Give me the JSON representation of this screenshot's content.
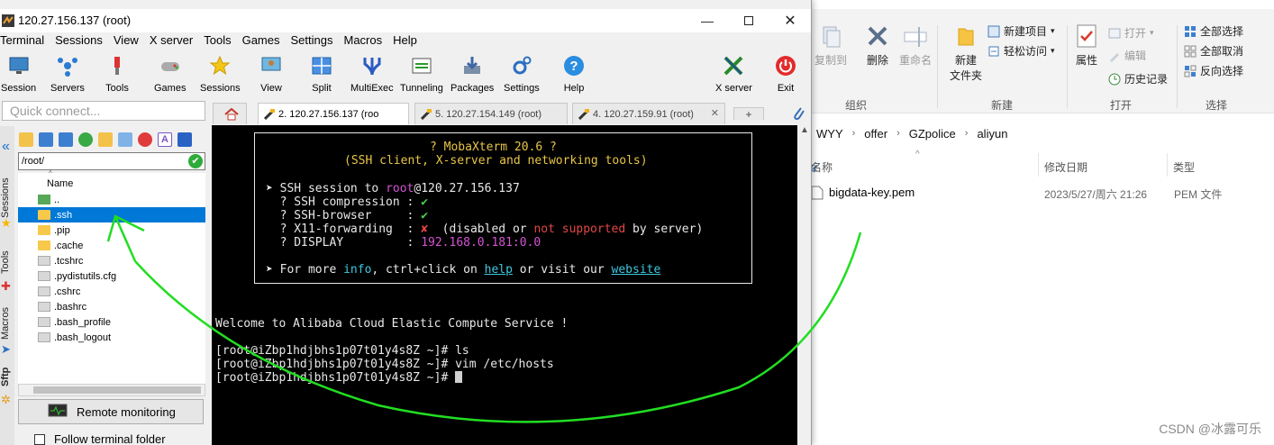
{
  "explorer": {
    "ribbon": {
      "copy_to": "复制到",
      "delete": "删除",
      "rename": "重命名",
      "new_folder": "新建\n文件夹",
      "new_item": "新建项目",
      "easy_access": "轻松访问",
      "properties": "属性",
      "open": "打开",
      "edit": "编辑",
      "history": "历史记录",
      "select_all": "全部选择",
      "select_none": "全部取消",
      "invert_selection": "反向选择",
      "group_organize": "组织",
      "group_new": "新建",
      "group_open": "打开",
      "group_select": "选择"
    },
    "breadcrumb": [
      "WYY",
      "offer",
      "GZpolice",
      "aliyun"
    ],
    "columns": {
      "name": "名称",
      "modified": "修改日期",
      "type": "类型"
    },
    "files": [
      {
        "name": "bigdata-key.pem",
        "modified": "2023/5/27/周六 21:26",
        "type": "PEM 文件"
      }
    ],
    "watermark": "CSDN @冰露可乐"
  },
  "moba": {
    "title": "120.27.156.137 (root)",
    "menu": [
      "Terminal",
      "Sessions",
      "View",
      "X server",
      "Tools",
      "Games",
      "Settings",
      "Macros",
      "Help"
    ],
    "toolbar": {
      "session": "Session",
      "servers": "Servers",
      "tools": "Tools",
      "games": "Games",
      "sessions": "Sessions",
      "view": "View",
      "split": "Split",
      "multiexec": "MultiExec",
      "tunneling": "Tunneling",
      "packages": "Packages",
      "settings": "Settings",
      "help": "Help",
      "xserver": "X server",
      "exit": "Exit"
    },
    "quick_connect_placeholder": "Quick connect...",
    "tabs": [
      {
        "label": "2. 120.27.156.137 (roo"
      },
      {
        "label": "5. 120.27.154.149 (root)"
      },
      {
        "label": "4. 120.27.159.91 (root)"
      }
    ],
    "side_tabs": {
      "sessions": "Sessions",
      "tools": "Tools",
      "macros": "Macros",
      "sftp": "Sftp"
    },
    "sftp": {
      "path": "/root/",
      "name_header": "Name",
      "files": [
        "..",
        ".ssh",
        ".pip",
        ".cache",
        ".tcshrc",
        ".pydistutils.cfg",
        ".cshrc",
        ".bashrc",
        ".bash_profile",
        ".bash_logout"
      ],
      "selected_index": 1,
      "remote_monitoring": "Remote monitoring",
      "follow_terminal": "Follow terminal folder"
    },
    "terminal": {
      "banner_title": "? MobaXterm 20.6 ?",
      "banner_subtitle": "(SSH client, X-server and networking tools)",
      "ssh_prefix": "➤ SSH session to ",
      "ssh_user": "root",
      "ssh_host": "@120.27.156.137",
      "compression": "  ? SSH compression : ",
      "browser": "  ? SSH-browser     : ",
      "x11": "  ? X11-forwarding  : ",
      "x11_disabled": "(disabled",
      "x11_or": " or ",
      "x11_not_supported": "not supported",
      "x11_tail": " by server)",
      "display": "  ? DISPLAY         : ",
      "display_value": "192.168.0.181:0.0",
      "more_prefix": "➤ For more ",
      "more_info": "info",
      "more_mid": ", ctrl+click on ",
      "more_help": "help",
      "more_or": " or visit our ",
      "more_website": "website",
      "welcome": "Welcome to Alibaba Cloud Elastic Compute Service !",
      "lines": [
        "[root@iZbp1hdjbhs1p07t01y4s8Z ~]# ls",
        "[root@iZbp1hdjbhs1p07t01y4s8Z ~]# vim /etc/hosts",
        "[root@iZbp1hdjbhs1p07t01y4s8Z ~]# "
      ]
    }
  },
  "colors": {
    "accent": "#0078d7",
    "annotation": "#22dd22",
    "terminal_bg": "#000000"
  }
}
